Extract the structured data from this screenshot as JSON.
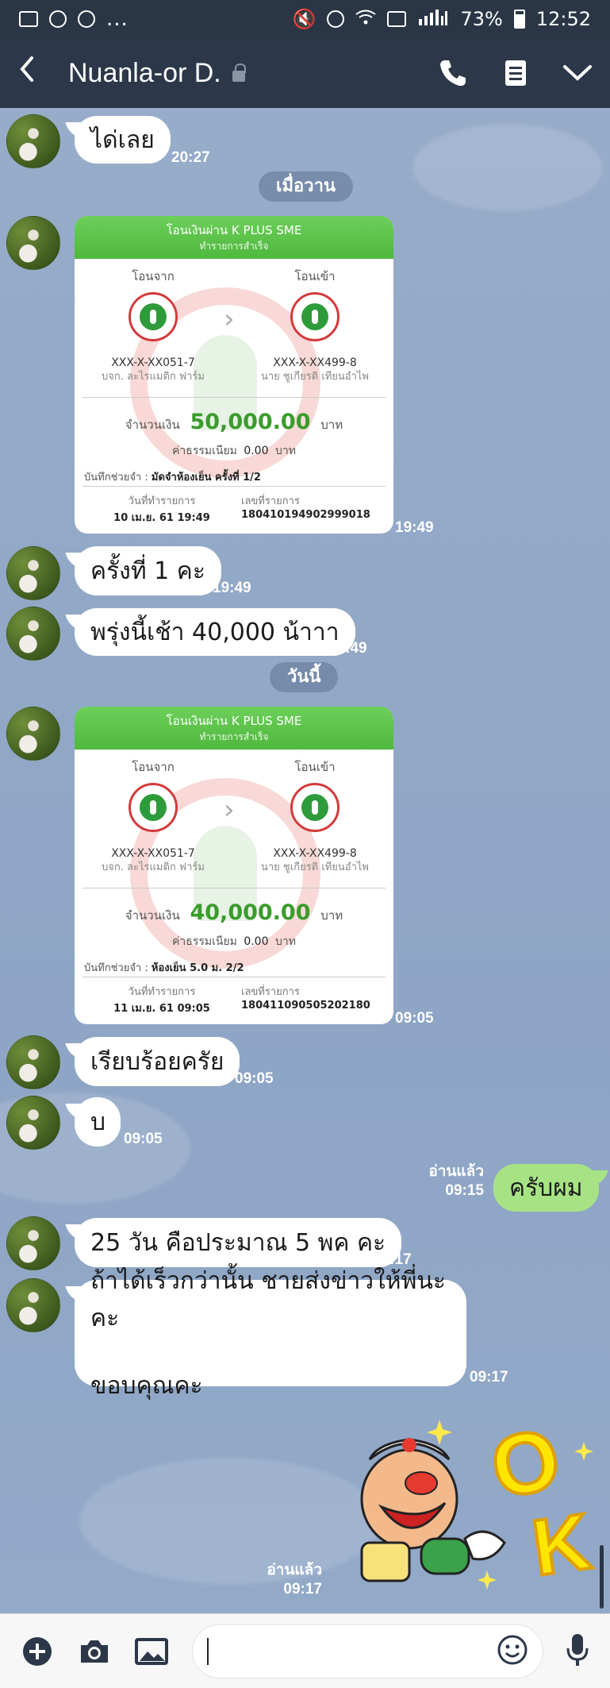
{
  "status_bar": {
    "battery": "73%",
    "time": "12:52",
    "dots": "..."
  },
  "header": {
    "title": "Nuanla-or D."
  },
  "date_pills": {
    "yesterday": "เมื่อวาน",
    "today": "วันนี้"
  },
  "messages": [
    {
      "text": "ได่เลย",
      "time": "20:27"
    },
    {
      "time": "19:49"
    },
    {
      "text": "ครั้งที่ 1 คะ",
      "time": "19:49"
    },
    {
      "text": "พรุ่งนี้เช้า 40,000 น้าาา",
      "time": "19:49"
    },
    {
      "time": "09:05"
    },
    {
      "text": "เรียบร้อยครัย",
      "time": "09:05"
    },
    {
      "text": "บ",
      "time": "09:05"
    },
    {
      "text": "ครับผม",
      "time": "09:15",
      "read": "อ่านแล้ว"
    },
    {
      "text": "25 วัน คือประมาณ 5 พค คะ",
      "time": "09:17"
    },
    {
      "line1": "ถ้าได้เร็วกว่านั้น ชายส่งข่าวให้พี่นะคะ",
      "line2": "ขอบคุณคะ",
      "time": "09:17"
    },
    {
      "time": "09:17",
      "read": "อ่านแล้ว"
    }
  ],
  "slips": [
    {
      "title": "โอนเงินผ่าน K PLUS SME",
      "subtitle": "ทำรายการสำเร็จ",
      "from_label": "โอนจาก",
      "to_label": "โอนเข้า",
      "from_account": "XXX-X-XX051-7",
      "from_name": "บจก. ละไรแมติก ฟาร์ม",
      "to_account": "XXX-X-XX499-8",
      "to_name": "นาย ชูเกียรติ เทียนอำไพ",
      "amount_label": "จำนวนเงิน",
      "amount": "50,000.00",
      "currency": "บาท",
      "fee_label": "ค่าธรรมเนียม",
      "fee": "0.00",
      "note_label": "บันทึกช่วยจำ :",
      "note": "มัดจำห้องเย็น ครั้งที่ 1/2",
      "date_label": "วันที่ทำรายการ",
      "date": "10 เม.ย. 61 19:49",
      "ref_label": "เลขที่รายการ",
      "ref": "180410194902999018"
    },
    {
      "title": "โอนเงินผ่าน K PLUS SME",
      "subtitle": "ทำรายการสำเร็จ",
      "from_label": "โอนจาก",
      "to_label": "โอนเข้า",
      "from_account": "XXX-X-XX051-7",
      "from_name": "บจก. ละไรแมติก ฟาร์ม",
      "to_account": "XXX-X-XX499-8",
      "to_name": "นาย ชูเกียรติ เทียนอำไพ",
      "amount_label": "จำนวนเงิน",
      "amount": "40,000.00",
      "currency": "บาท",
      "fee_label": "ค่าธรรมเนียม",
      "fee": "0.00",
      "note_label": "บันทึกช่วยจำ :",
      "note": "ห้องเย็น 5.0 ม. 2/2",
      "date_label": "วันที่ทำรายการ",
      "date": "11 เม.ย. 61 09:05",
      "ref_label": "เลขที่รายการ",
      "ref": "180411090505202180"
    }
  ],
  "colors": {
    "header_bg": "#2c3849",
    "chat_bg": "#8fa6c6",
    "outgoing_bubble": "#a7e385",
    "slip_green": "#4fb83d"
  }
}
